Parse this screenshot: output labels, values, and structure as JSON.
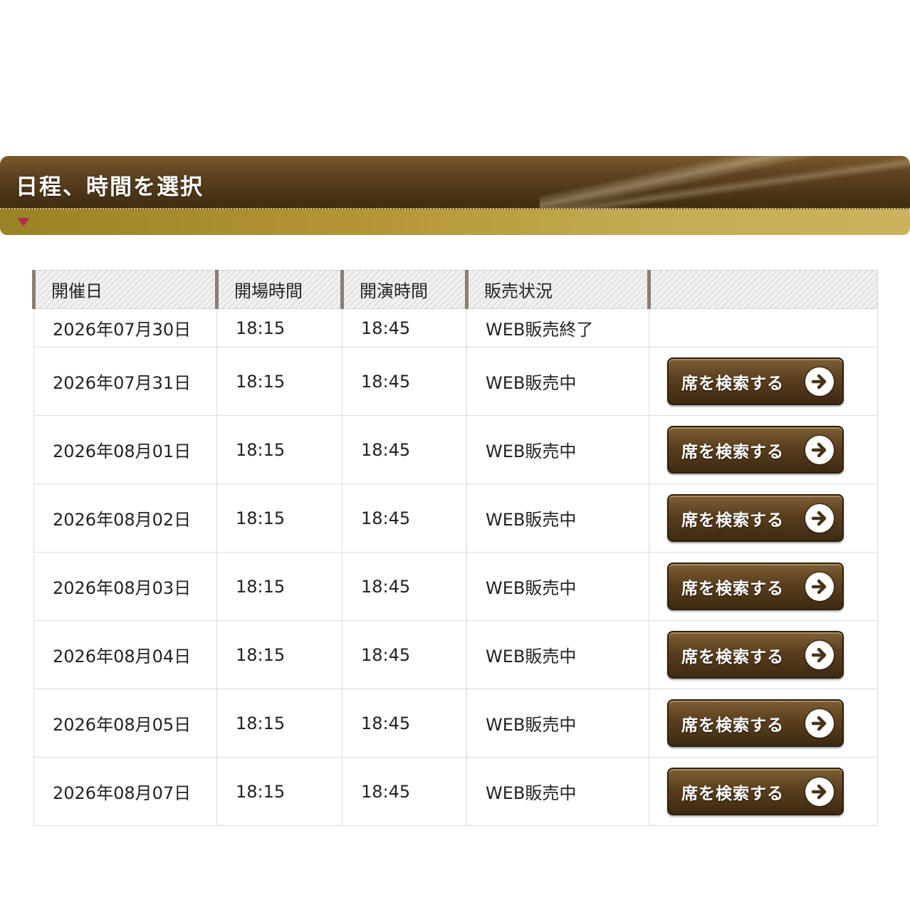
{
  "section": {
    "title": "日程、時間を選択"
  },
  "table": {
    "headers": [
      "開催日",
      "開場時間",
      "開演時間",
      "販売状況",
      ""
    ],
    "rows": [
      {
        "date": "2026年07月30日",
        "open": "18:15",
        "start": "18:45",
        "status": "WEB販売終了",
        "button": null
      },
      {
        "date": "2026年07月31日",
        "open": "18:15",
        "start": "18:45",
        "status": "WEB販売中",
        "button": "席を検索する"
      },
      {
        "date": "2026年08月01日",
        "open": "18:15",
        "start": "18:45",
        "status": "WEB販売中",
        "button": "席を検索する"
      },
      {
        "date": "2026年08月02日",
        "open": "18:15",
        "start": "18:45",
        "status": "WEB販売中",
        "button": "席を検索する"
      },
      {
        "date": "2026年08月03日",
        "open": "18:15",
        "start": "18:45",
        "status": "WEB販売中",
        "button": "席を検索する"
      },
      {
        "date": "2026年08月04日",
        "open": "18:15",
        "start": "18:45",
        "status": "WEB販売中",
        "button": "席を検索する"
      },
      {
        "date": "2026年08月05日",
        "open": "18:15",
        "start": "18:45",
        "status": "WEB販売中",
        "button": "席を検索する"
      },
      {
        "date": "2026年08月07日",
        "open": "18:15",
        "start": "18:45",
        "status": "WEB販売中",
        "button": "席を検索する"
      }
    ]
  },
  "icons": {
    "section_marker": "triangle-down-icon",
    "button_icon": "arrow-right-circle-icon"
  },
  "colors": {
    "banner_dark": "#3f2c12",
    "banner_gold": "#c6ad55",
    "marker": "#b0304a",
    "button": "#5a3f1e"
  }
}
